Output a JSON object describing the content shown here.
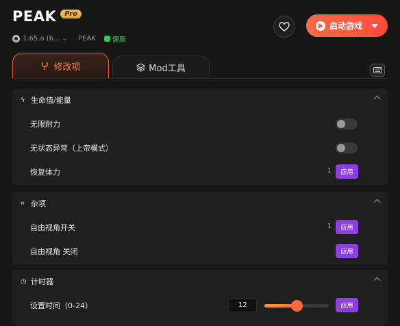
{
  "header": {
    "title": "PEAK",
    "badge": "Pro",
    "version": "1.65.a (6...",
    "game_name": "PEAK",
    "status": "健康",
    "launch_label": "启动游戏"
  },
  "tabs": [
    {
      "label": "修改项",
      "active": true
    },
    {
      "label": "Mod工具",
      "active": false
    }
  ],
  "sections": {
    "health": {
      "title": "生命值/能量",
      "rows": [
        {
          "label": "无限耐力",
          "control": "toggle",
          "on": false
        },
        {
          "label": "无状态异常（上帝模式）",
          "control": "toggle",
          "on": false
        },
        {
          "label": "恢复体力",
          "control": "apply",
          "count": "1",
          "button": "应用"
        }
      ]
    },
    "misc": {
      "title": "杂项",
      "rows": [
        {
          "label": "自由视角开关",
          "control": "apply",
          "count": "1",
          "button": "应用"
        },
        {
          "label": "自由视角 关闭",
          "control": "apply",
          "button": "应用"
        }
      ]
    },
    "timer": {
      "title": "计时器",
      "rows": [
        {
          "label": "设置时间（0-24）",
          "control": "slider",
          "value": "12",
          "slider_fraction": 0.5,
          "button": "应用"
        }
      ]
    }
  },
  "colors": {
    "accent_orange": "#ff5a42",
    "apply_purple": "#8d3fe0",
    "status_green": "#34c759"
  }
}
